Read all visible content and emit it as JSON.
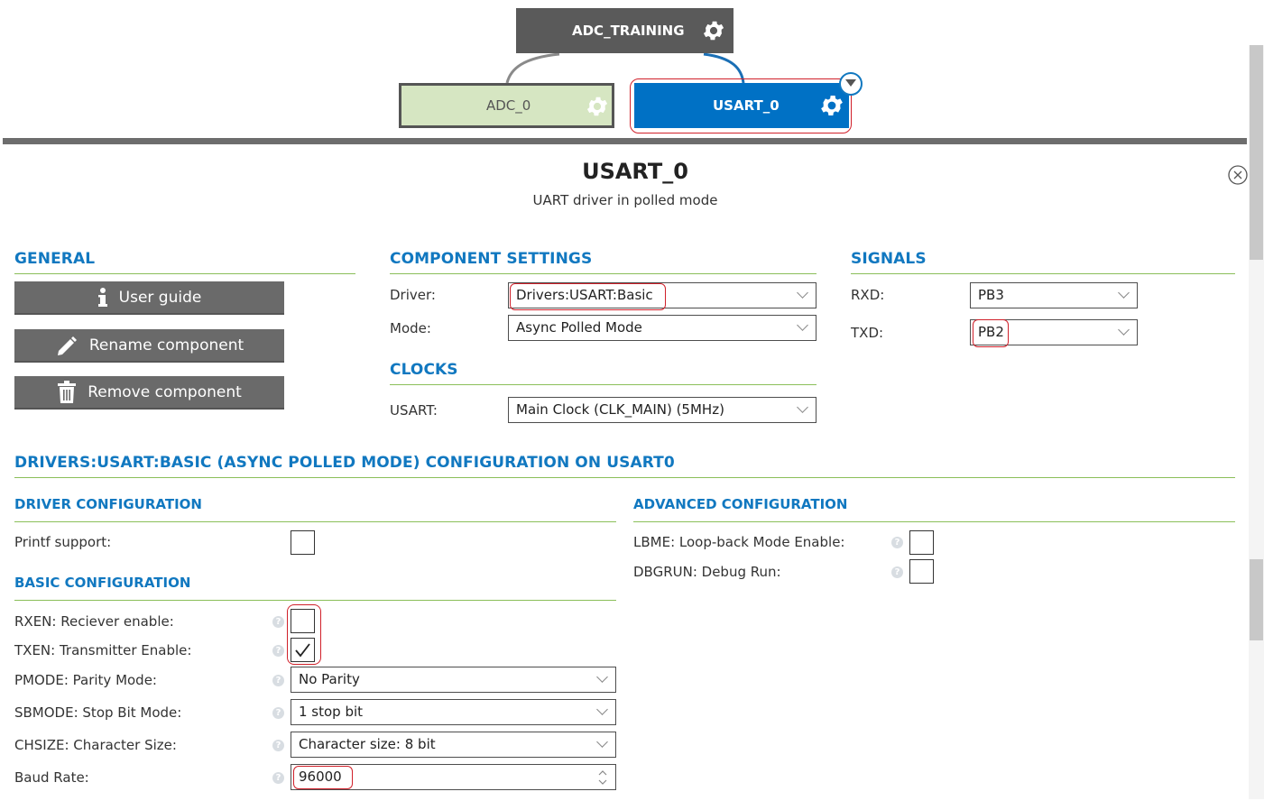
{
  "diagram": {
    "root": {
      "label": "ADC_TRAINING"
    },
    "children": [
      {
        "label": "ADC_0"
      },
      {
        "label": "USART_0"
      }
    ]
  },
  "panel": {
    "title": "USART_0",
    "subtitle": "UART driver in polled mode"
  },
  "general": {
    "heading": "GENERAL",
    "buttons": [
      {
        "label": "User guide",
        "icon": "info-icon"
      },
      {
        "label": "Rename component",
        "icon": "pencil-icon"
      },
      {
        "label": "Remove component",
        "icon": "trash-icon"
      }
    ]
  },
  "component_settings": {
    "heading": "COMPONENT SETTINGS",
    "driver_label": "Driver:",
    "driver_value": "Drivers:USART:Basic",
    "mode_label": "Mode:",
    "mode_value": "Async Polled Mode"
  },
  "clocks": {
    "heading": "CLOCKS",
    "usart_label": "USART:",
    "usart_value": "Main Clock (CLK_MAIN) (5MHz)"
  },
  "signals": {
    "heading": "SIGNALS",
    "rxd_label": "RXD:",
    "rxd_value": "PB3",
    "txd_label": "TXD:",
    "txd_value": "PB2"
  },
  "config": {
    "heading": "DRIVERS:USART:BASIC (ASYNC POLLED MODE) CONFIGURATION ON USART0",
    "driver_config": {
      "heading": "DRIVER CONFIGURATION",
      "printf_label": "Printf support:",
      "printf_checked": false
    },
    "basic_config": {
      "heading": "BASIC CONFIGURATION",
      "rxen_label": "RXEN: Reciever enable:",
      "rxen_checked": false,
      "txen_label": "TXEN: Transmitter Enable:",
      "txen_checked": true,
      "pmode_label": "PMODE: Parity Mode:",
      "pmode_value": "No Parity",
      "sbmode_label": "SBMODE: Stop Bit Mode:",
      "sbmode_value": "1 stop bit",
      "chsize_label": "CHSIZE: Character Size:",
      "chsize_value": "Character size: 8 bit",
      "baud_label": "Baud Rate:",
      "baud_value": "96000"
    },
    "advanced_config": {
      "heading": "ADVANCED CONFIGURATION",
      "lbme_label": "LBME: Loop-back Mode Enable:",
      "lbme_checked": false,
      "dbgrun_label": "DBGRUN: Debug Run:",
      "dbgrun_checked": false
    }
  },
  "colors": {
    "accent": "#1178c0",
    "rule": "#8bbf5a",
    "highlight": "#d0202a",
    "node_dark": "#5a5a5a",
    "node_green": "#d6e6c2",
    "node_blue": "#0071c5"
  }
}
